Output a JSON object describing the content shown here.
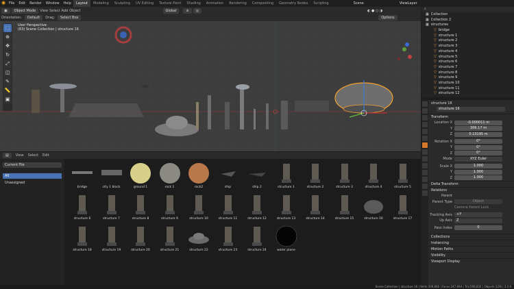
{
  "topbar": {
    "menus": [
      "File",
      "Edit",
      "Render",
      "Window",
      "Help"
    ],
    "workspaces": [
      "Layout",
      "Modeling",
      "Sculpting",
      "UV Editing",
      "Texture Paint",
      "Shading",
      "Animation",
      "Rendering",
      "Compositing",
      "Geometry Nodes",
      "Scripting"
    ],
    "active_workspace": "Layout",
    "scene": "Scene",
    "view_layer": "ViewLayer"
  },
  "viewport_header": {
    "mode": "Object Mode",
    "menus": [
      "View",
      "Select",
      "Add",
      "Object"
    ],
    "transform": "Global",
    "options": "Options"
  },
  "tool_settings": {
    "orientation_label": "Orientation:",
    "orientation": "Default",
    "drag_label": "Drag:",
    "drag": "Select Box"
  },
  "viewport": {
    "line1": "User Perspective",
    "line2": "(63) Scene Collection | structure 16"
  },
  "filebrowser": {
    "menus": [
      "View",
      "Select",
      "Edit"
    ],
    "library": "Current File",
    "categories": [
      "All",
      "Unassigned"
    ],
    "assets": [
      "bridge",
      "city 1 block",
      "ground 1",
      "rock 1",
      "rock2",
      "ship",
      "ship 2",
      "structure 1",
      "structure 2",
      "structure 3",
      "structure 4",
      "structure 5",
      "structure 6",
      "structure 7",
      "structure 8",
      "structure 9",
      "structure 10",
      "structure 11",
      "structure 12",
      "structure 13",
      "structure 14",
      "structure 15",
      "structure 16",
      "structure 17",
      "structure 18",
      "structure 19",
      "structure 20",
      "structure 21",
      "structure 22",
      "structure 23",
      "structure 24",
      "water plane"
    ]
  },
  "outliner": {
    "rows": [
      "Collection",
      "Collection 2",
      "structures",
      "bridge",
      "structure 1",
      "structure 2",
      "structure 3",
      "structure 4",
      "structure 5",
      "structure 6",
      "structure 7",
      "structure 8",
      "structure 9",
      "structure 10",
      "structure 11",
      "structure 12"
    ]
  },
  "properties": {
    "object_name": "structure 16",
    "object_field": "structure 16",
    "transform_header": "Transform",
    "location_label": "Location X",
    "location": [
      "-0.000011 m",
      "306.17 m",
      "0.13195 m"
    ],
    "rotation_label": "Rotation X",
    "rotation": [
      "0°",
      "0°",
      "0°"
    ],
    "mode_label": "Mode",
    "mode": "XYZ Euler",
    "scale_label": "Scale X",
    "scale": [
      "1.000",
      "1.000",
      "1.000"
    ],
    "y_label": "Y",
    "z_label": "Z",
    "delta": "Delta Transform",
    "relations": "Relations",
    "parent_label": "Parent",
    "parent_type_label": "Parent Type",
    "parent_type": "Object",
    "camera_parent_lock": "Camera Parent Lock",
    "tracking_axis_label": "Tracking Axis",
    "tracking_axis": "+Y",
    "up_axis_label": "Up Axis",
    "up_axis": "Z",
    "pass_index_label": "Pass Index",
    "pass_index": "0",
    "sections": [
      "Collections",
      "Instancing",
      "Motion Paths",
      "Visibility",
      "Viewport Display"
    ]
  },
  "statusbar": {
    "text": "Scene Collection | structure 16 | Verts:309,660 | Faces:247,694 | Tris:506,832 | Objects:1/28 | 3.2.0"
  },
  "colors": {
    "accent": "#4772b3",
    "selection": "#f59f2c",
    "bg": "#1d1d1d"
  }
}
